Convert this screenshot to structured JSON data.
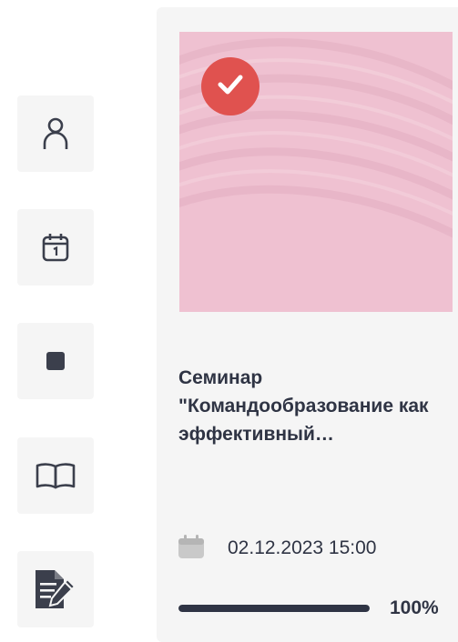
{
  "sidebar": {
    "items": [
      {
        "icon": "user-icon"
      },
      {
        "icon": "calendar-icon"
      },
      {
        "icon": "stop-square-icon"
      },
      {
        "icon": "book-icon"
      },
      {
        "icon": "edit-document-icon"
      }
    ]
  },
  "card": {
    "completed_icon": "check-icon",
    "title": "Семинар \"Командообразование как эффективный…",
    "date": "02.12.2023 15:00",
    "progress": 1.0,
    "progress_label": "100%"
  },
  "colors": {
    "thumb_background": "#efc1d1",
    "badge": "#e0524f",
    "text": "#2f3444",
    "icon": "#3b3f4c"
  }
}
